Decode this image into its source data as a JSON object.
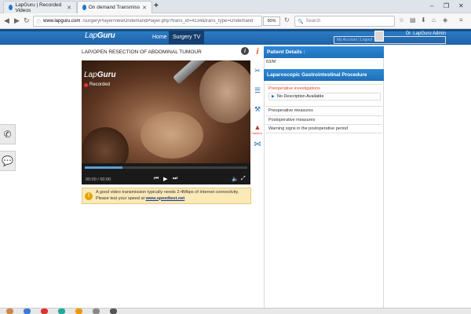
{
  "browser": {
    "tabs": [
      {
        "label": "LapGuru | Recorded Videos"
      },
      {
        "label": "On demand Transmission : LAP..."
      }
    ],
    "url_host": "www.lapguru.com",
    "url_path": "/surgeryPlayer/viewOndemandPlayer.php?trans_id=4134&trans_type=Ondemand",
    "zoom": "90%",
    "search_placeholder": "Search"
  },
  "site": {
    "logo_light": "Lap",
    "logo_bold": "Guru",
    "nav": [
      {
        "label": "Home"
      },
      {
        "label": "Surgery TV"
      }
    ],
    "user_name": "Dr. LapGuru Admin",
    "user_links": "My Account | Logout"
  },
  "main": {
    "title": "LAP/OPEN RESECTION OF ABDOMINAL TUMOUR",
    "video": {
      "logo_light": "Lap",
      "logo_bold": "Guru",
      "status": "Recorded",
      "time": "00:00 / 00:00",
      "progress": 0.23
    },
    "notice_line1": "A good video transmission typically needs 2-4Mbps of Internet connectivity.",
    "notice_line2_prefix": "Please test your speed at ",
    "notice_link": "www.speedtest.net"
  },
  "panel": {
    "patient_header": "Patient Details :",
    "patient_value": "63/M",
    "procedure_header": "Laparoscopic Gastrointestinal Procedure",
    "sections": [
      {
        "label": "Preoperative investigations"
      },
      {
        "label": "Preoperative measures"
      },
      {
        "label": "Postoperative measures"
      }
    ],
    "sub_item": "No Description Available",
    "warning_item": "Warning signs in the postoperative period",
    "caution_label": "Caution"
  },
  "icons": [
    "info-icon",
    "scissors-icon",
    "list-icon",
    "instruments-icon",
    "caution-icon",
    "share-icon",
    "phone-icon",
    "chat-icon"
  ]
}
